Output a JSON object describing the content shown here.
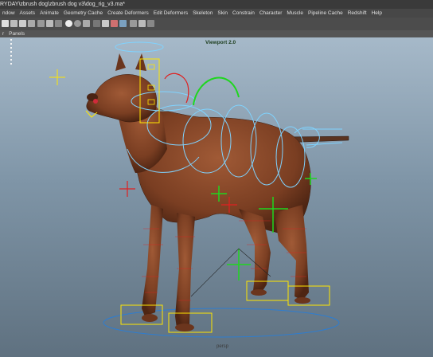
{
  "title": "RYDAY\\zbrush dog\\zbrush dog v3\\dog_rig_v3.ma*",
  "menu": [
    "ndow",
    "Assets",
    "Animate",
    "Geometry Cache",
    "Create Deformers",
    "Edit Deformers",
    "Skeleton",
    "Skin",
    "Constrain",
    "Character",
    "Muscle",
    "Pipeline Cache",
    "Redshift",
    "Help"
  ],
  "panel_menu": [
    "r",
    "Panels"
  ],
  "viewport": {
    "label": "Viewport 2.0",
    "camera": "persp"
  },
  "colors": {
    "rig_curve": "#7fd3ff",
    "ik_box": "#ffe600",
    "joint": "#e02020",
    "locator": "#1fd61f",
    "dog_base": "#7a3e22"
  }
}
